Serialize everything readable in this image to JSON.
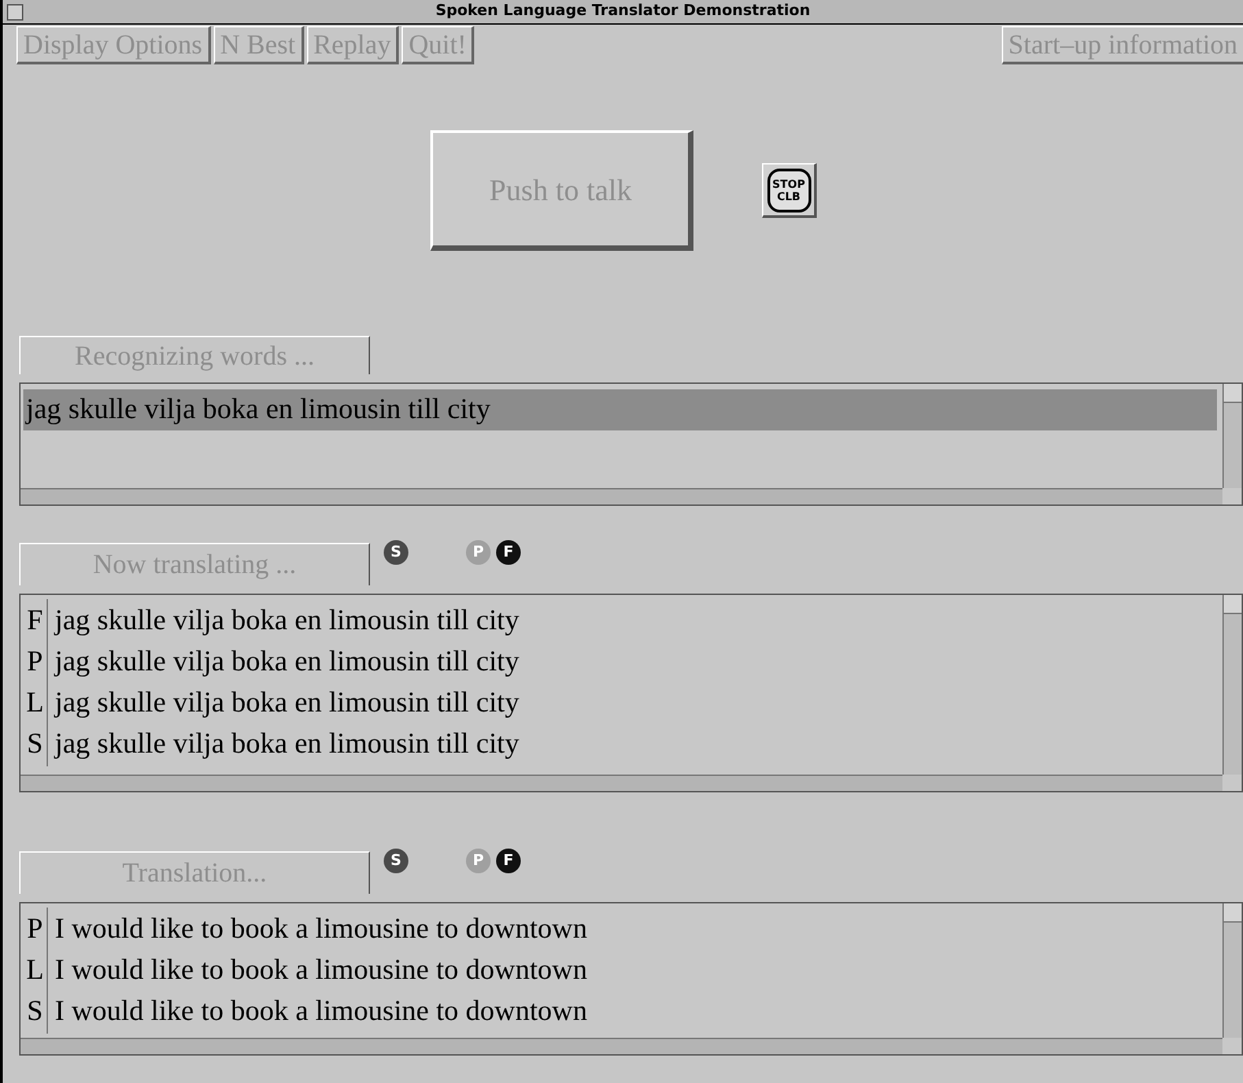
{
  "window": {
    "title": "Spoken Language Translator Demonstration"
  },
  "menu_buttons": [
    {
      "label": "Display Options",
      "disabled": true
    },
    {
      "label": "N Best",
      "disabled": true
    },
    {
      "label": "Replay",
      "disabled": true
    },
    {
      "label": "Quit!",
      "disabled": true
    }
  ],
  "info_button": {
    "label": "Start–up information",
    "disabled": true
  },
  "talk_button": {
    "label": "Push to talk",
    "disabled": true
  },
  "stop_button": {
    "lines": [
      "STOP",
      "CLB"
    ]
  },
  "sections": [
    {
      "status": "Recognizing words ...",
      "rows": [
        {
          "tag": "",
          "text": "jag skulle vilja boka en limousin till city",
          "selected": true
        }
      ]
    },
    {
      "status": "Now translating ...",
      "indicators": [
        {
          "letter": "S",
          "color": "#4a4a4a"
        },
        {
          "letter": "P",
          "color": "#a0a0a0"
        },
        {
          "letter": "F",
          "color": "#111111"
        }
      ],
      "rows": [
        {
          "tag": "F",
          "text": "jag skulle vilja boka en limousin till city",
          "selected": false
        },
        {
          "tag": "P",
          "text": "jag skulle vilja boka en limousin till city",
          "selected": false
        },
        {
          "tag": "L",
          "text": "jag skulle vilja boka en limousin till city",
          "selected": false
        },
        {
          "tag": "S",
          "text": "jag skulle vilja boka en limousin till city",
          "selected": false
        }
      ]
    },
    {
      "status": "Translation...",
      "indicators": [
        {
          "letter": "S",
          "color": "#4a4a4a"
        },
        {
          "letter": "P",
          "color": "#a0a0a0"
        },
        {
          "letter": "F",
          "color": "#111111"
        }
      ],
      "rows": [
        {
          "tag": "P",
          "text": "I would like to book a limousine to downtown",
          "selected": false
        },
        {
          "tag": "L",
          "text": "I would like to book a limousine to downtown",
          "selected": false
        },
        {
          "tag": "S",
          "text": "I would like to book a limousine to downtown",
          "selected": false
        }
      ]
    }
  ]
}
